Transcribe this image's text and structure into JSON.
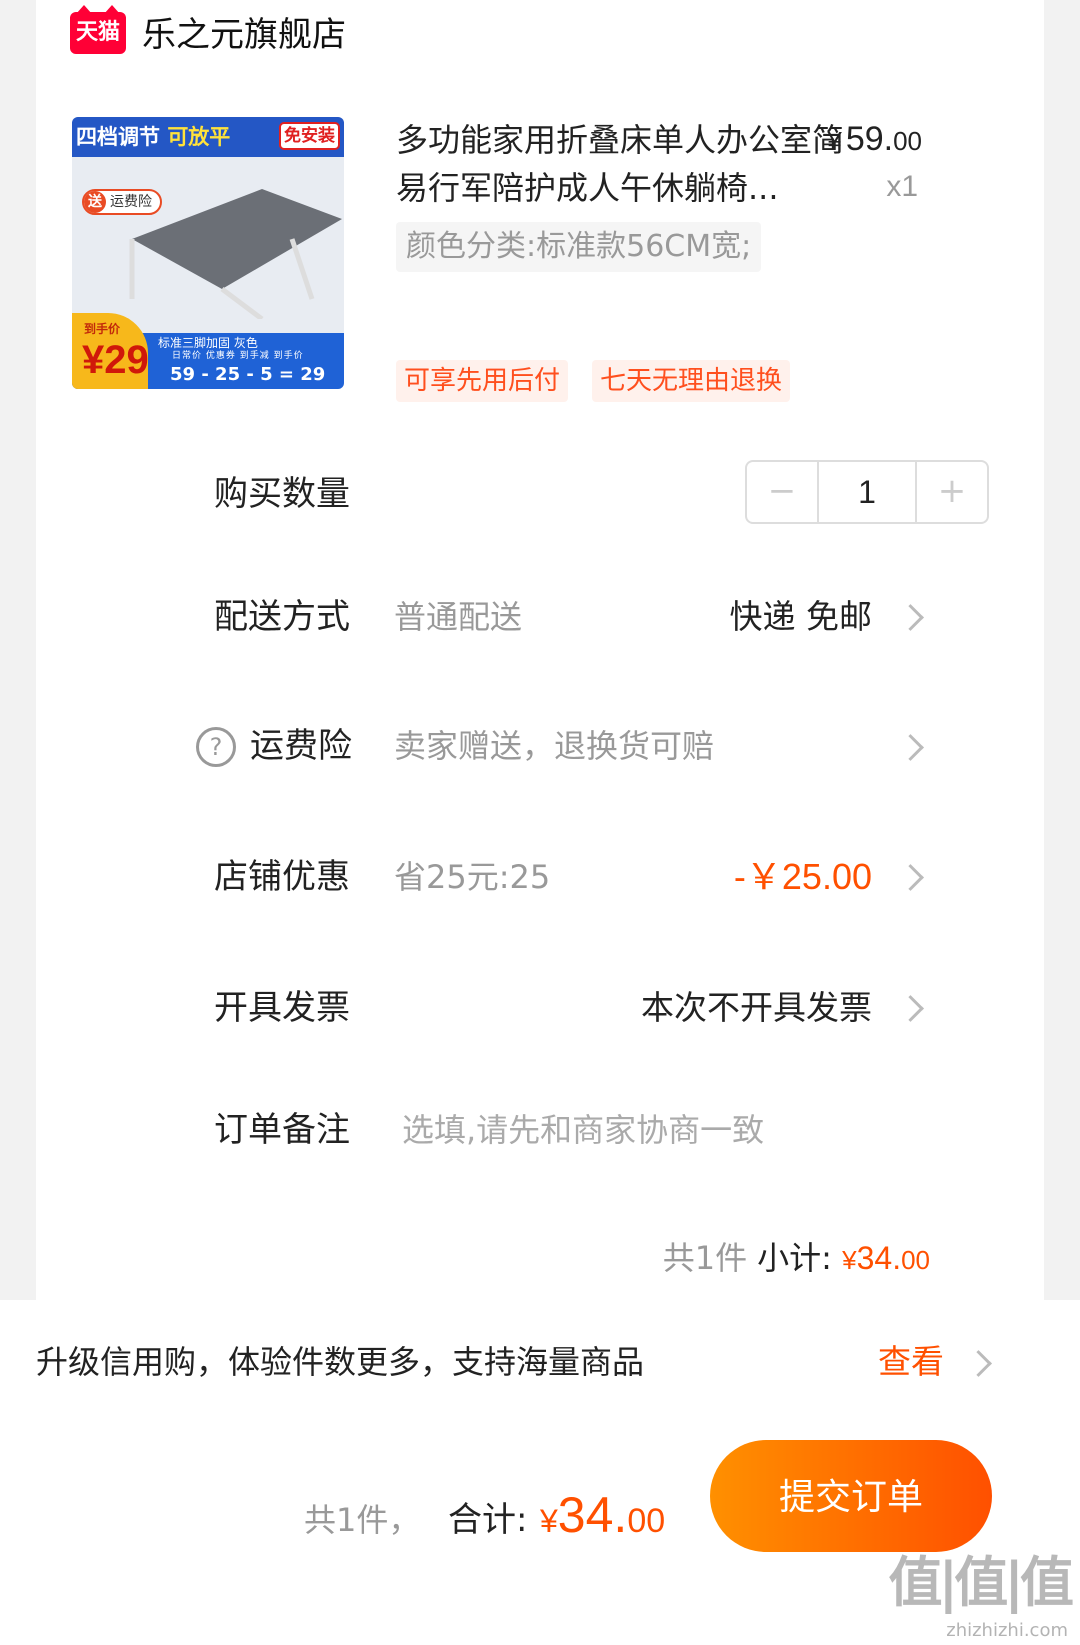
{
  "store": {
    "logo_text": "天猫",
    "name": "乐之元旗舰店"
  },
  "product": {
    "image": {
      "title_part1": "四档调节",
      "title_part2": "可放平",
      "badge": "免安装",
      "insurance_tag": "运费险",
      "insurance_mark": "送",
      "price_label": "到手价",
      "price": "¥29",
      "top_note": "标准三脚加固    灰色",
      "sub_labels": "日常价   优惠券   到手减   到手价",
      "formula": "59 - 25 - 5 = 29"
    },
    "title": "多功能家用折叠床单人办公室简易行军陪护成人午休躺椅...",
    "price_currency": "¥",
    "price_int": "59.",
    "price_dec": "00",
    "quantity": "x1",
    "sku": "颜色分类:标准款56CM宽;",
    "service_tags": [
      "可享先用后付",
      "七天无理由退换"
    ]
  },
  "rows": {
    "quantity": {
      "label": "购买数量",
      "minus": "−",
      "value": "1",
      "plus": "+"
    },
    "delivery": {
      "label": "配送方式",
      "value": "普通配送",
      "right": "快递 免邮"
    },
    "insurance": {
      "label": "运费险",
      "value": "卖家赠送，退换货可赔",
      "help": "?"
    },
    "coupon": {
      "label": "店铺优惠",
      "value": "省25元:25",
      "right": "-￥25.00"
    },
    "invoice": {
      "label": "开具发票",
      "right": "本次不开具发票"
    },
    "note": {
      "label": "订单备注",
      "placeholder": "选填,请先和商家协商一致"
    }
  },
  "subtotal": {
    "count": "共1件",
    "label": "小计:",
    "currency": "¥",
    "int": "34.",
    "dec": "00"
  },
  "credit": {
    "text": "升级信用购，体验件数更多，支持海量商品",
    "link": "查看"
  },
  "footer": {
    "count": "共1件，",
    "label": "合计:",
    "currency": "¥",
    "int": "34.",
    "dec": "00",
    "submit": "提交订单",
    "watermark": "值|值|值",
    "watermark_url": "zhizhizhi.com"
  },
  "colors": {
    "accent": "#ff5000",
    "tmall": "#ff0036"
  }
}
